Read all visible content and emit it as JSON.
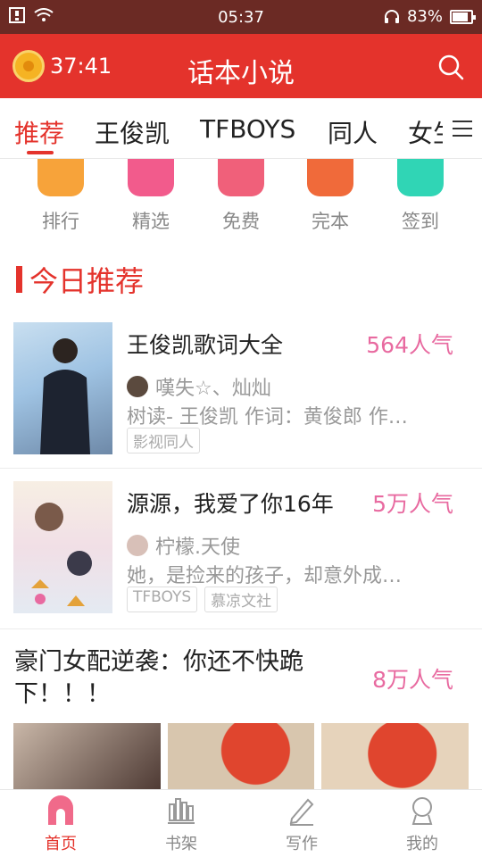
{
  "status_bar": {
    "time": "05:37",
    "battery": "83%"
  },
  "header": {
    "timer": "37:41",
    "title": "话本小说"
  },
  "tabs": [
    "推荐",
    "王俊凯",
    "TFBOYS",
    "同人",
    "女生"
  ],
  "quick_links": [
    {
      "label": "排行",
      "icon": "trophy-icon",
      "color": "#f7a33a"
    },
    {
      "label": "精选",
      "icon": "star-icon",
      "color": "#f25b8c"
    },
    {
      "label": "免费",
      "icon": "free-icon",
      "color": "#f0607a"
    },
    {
      "label": "完本",
      "icon": "check-icon",
      "color": "#f06a3a"
    },
    {
      "label": "签到",
      "icon": "sign-icon",
      "color": "#30d5b5"
    }
  ],
  "section": {
    "title": "今日推荐"
  },
  "books": [
    {
      "title": "王俊凯歌词大全",
      "popularity": "564人气",
      "author": "嘆失☆、灿灿",
      "description": "树读- 王俊凯 作词：黄俊郎 作…",
      "tags": [
        "影视同人"
      ]
    },
    {
      "title": "源源，我爱了你16年",
      "popularity": "5万人气",
      "author": "柠檬.天使",
      "description": "她，是捡来的孩子，却意外成…",
      "tags": [
        "TFBOYS",
        "慕凉文社"
      ]
    }
  ],
  "featured": {
    "title": "豪门女配逆袭：你还不快跪下！！！",
    "popularity": "8万人气"
  },
  "bottom_nav": [
    {
      "label": "首页",
      "icon": "home-icon",
      "active": true
    },
    {
      "label": "书架",
      "icon": "bookshelf-icon",
      "active": false
    },
    {
      "label": "写作",
      "icon": "pencil-icon",
      "active": false
    },
    {
      "label": "我的",
      "icon": "profile-icon",
      "active": false
    }
  ],
  "colors": {
    "brand": "#e4332c",
    "popularity": "#e86aa0"
  }
}
